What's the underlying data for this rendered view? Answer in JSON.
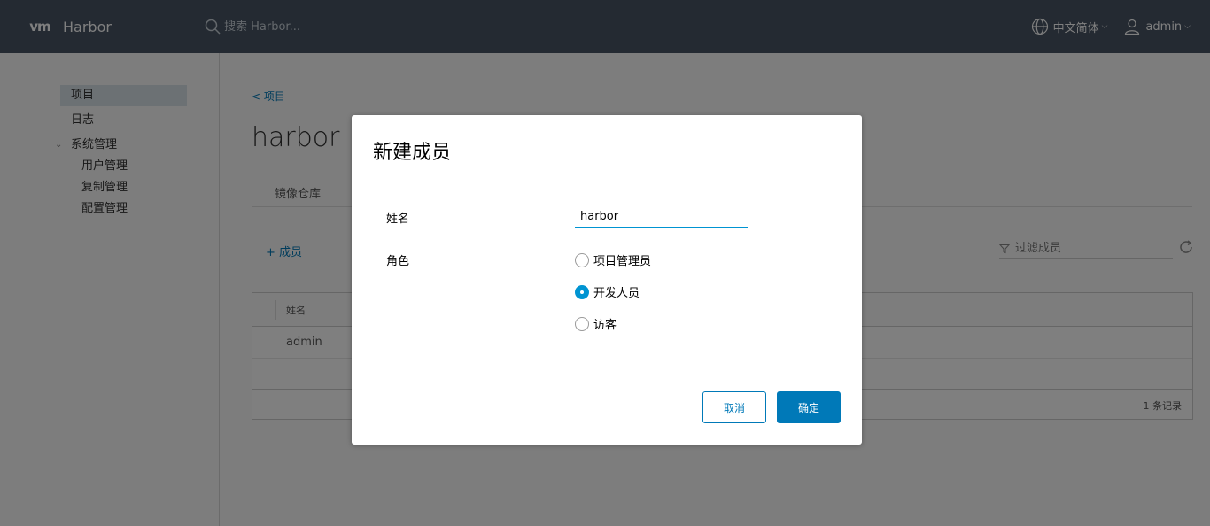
{
  "header": {
    "logo": "vm",
    "brand": "Harbor",
    "search_placeholder": "搜索 Harbor...",
    "language": "中文简体",
    "user": "admin"
  },
  "sidebar": {
    "items": [
      {
        "label": "项目"
      },
      {
        "label": "日志"
      }
    ],
    "group": {
      "label": "系统管理",
      "children": [
        {
          "label": "用户管理"
        },
        {
          "label": "复制管理"
        },
        {
          "label": "配置管理"
        }
      ]
    }
  },
  "main": {
    "back_link": "< 项目",
    "project_title": "harbor",
    "tab": "镜像仓库",
    "add_member": "+ 成员",
    "filter_placeholder": "过滤成员",
    "grid": {
      "columns": [
        "姓名"
      ],
      "rows": [
        [
          "admin"
        ]
      ],
      "footer": "1 条记录"
    }
  },
  "modal": {
    "title": "新建成员",
    "name_label": "姓名",
    "name_value": "harbor",
    "role_label": "角色",
    "roles": [
      {
        "label": "项目管理员",
        "checked": false
      },
      {
        "label": "开发人员",
        "checked": true
      },
      {
        "label": "访客",
        "checked": false
      }
    ],
    "cancel": "取消",
    "ok": "确定"
  },
  "colors": {
    "header_bg": "#485564",
    "accent": "#0079b8",
    "radio_active": "#0094d2"
  }
}
